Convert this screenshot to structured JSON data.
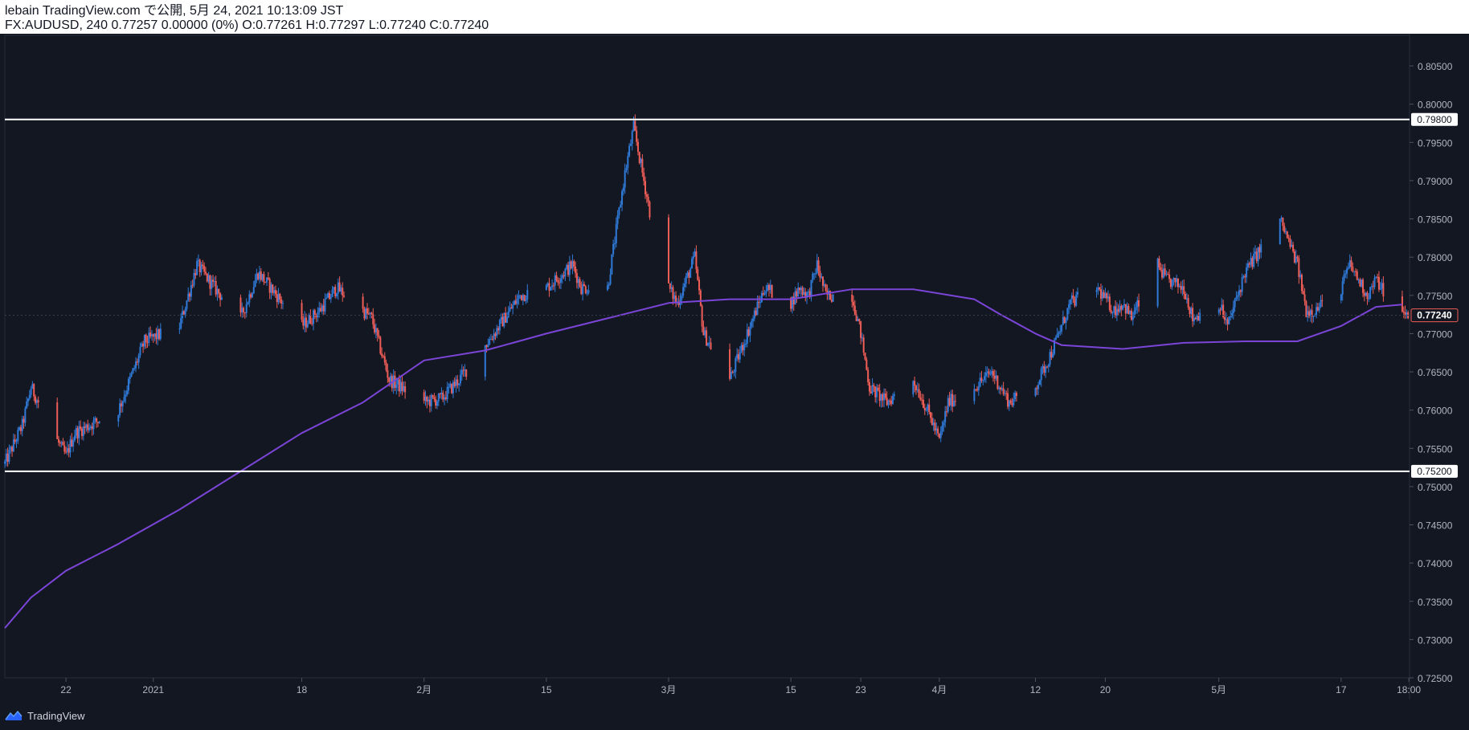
{
  "header": {
    "line1": "lebain TradingView.com で公開, 5月 24, 2021 10:13:09 JST",
    "line2": "FX:AUDUSD, 240 0.77257 0.00000 (0%) O:0.77261 H:0.77297 L:0.77240 C:0.77240"
  },
  "footer": {
    "brand": "TradingView",
    "logo_icon": "tradingview-logo-icon"
  },
  "colors": {
    "background": "#131722",
    "up": "#2f7ad8",
    "down": "#ef5d57",
    "ma": "#7b45d8",
    "level_line": "#ffffff",
    "axis_text": "#b2b5be",
    "grid": "#2a2e39"
  },
  "chart_data": {
    "type": "candlestick",
    "symbol": "FX:AUDUSD",
    "interval": "240",
    "ylim": [
      0.725,
      0.809
    ],
    "y_ticks": [
      "0.80500",
      "0.80000",
      "0.79500",
      "0.79000",
      "0.78500",
      "0.78000",
      "0.77500",
      "0.77000",
      "0.76500",
      "0.76000",
      "0.75500",
      "0.75000",
      "0.74500",
      "0.74000",
      "0.73500",
      "0.73000",
      "0.72500"
    ],
    "x_ticks": [
      {
        "label": "22",
        "date": "2020-12-22"
      },
      {
        "label": "2021",
        "date": "2021-01-01"
      },
      {
        "label": "18",
        "date": "2021-01-18"
      },
      {
        "label": "2月",
        "date": "2021-02-01"
      },
      {
        "label": "15",
        "date": "2021-02-15"
      },
      {
        "label": "3月",
        "date": "2021-03-01"
      },
      {
        "label": "15",
        "date": "2021-03-15"
      },
      {
        "label": "23",
        "date": "2021-03-23"
      },
      {
        "label": "4月",
        "date": "2021-04-01"
      },
      {
        "label": "12",
        "date": "2021-04-12"
      },
      {
        "label": "20",
        "date": "2021-04-20"
      },
      {
        "label": "5月",
        "date": "2021-05-03"
      },
      {
        "label": "17",
        "date": "2021-05-17"
      },
      {
        "label": "18:00",
        "date": "2021-05-24 18:00"
      }
    ],
    "price_path": [
      [
        "2020-12-15",
        0.753
      ],
      [
        "2020-12-17",
        0.758
      ],
      [
        "2020-12-18",
        0.763
      ],
      [
        "2020-12-21",
        0.756
      ],
      [
        "2020-12-22",
        0.754
      ],
      [
        "2020-12-23",
        0.757
      ],
      [
        "2020-12-28",
        0.76
      ],
      [
        "2020-12-31",
        0.769
      ],
      [
        "2021-01-04",
        0.771
      ],
      [
        "2021-01-06",
        0.779
      ],
      [
        "2021-01-08",
        0.776
      ],
      [
        "2021-01-11",
        0.772
      ],
      [
        "2021-01-13",
        0.778
      ],
      [
        "2021-01-18",
        0.771
      ],
      [
        "2021-01-20",
        0.773
      ],
      [
        "2021-01-22",
        0.776
      ],
      [
        "2021-01-26",
        0.772
      ],
      [
        "2021-01-28",
        0.764
      ],
      [
        "2021-02-01",
        0.761
      ],
      [
        "2021-02-03",
        0.7615
      ],
      [
        "2021-02-05",
        0.764
      ],
      [
        "2021-02-09",
        0.77
      ],
      [
        "2021-02-12",
        0.775
      ],
      [
        "2021-02-15",
        0.776
      ],
      [
        "2021-02-18",
        0.779
      ],
      [
        "2021-02-19",
        0.776
      ],
      [
        "2021-02-22",
        0.776
      ],
      [
        "2021-02-24",
        0.791
      ],
      [
        "2021-02-25",
        0.797
      ],
      [
        "2021-02-26",
        0.791
      ],
      [
        "2021-02-27",
        0.785
      ],
      [
        "2021-03-01",
        0.776
      ],
      [
        "2021-03-02",
        0.774
      ],
      [
        "2021-03-04",
        0.78
      ],
      [
        "2021-03-05",
        0.77
      ],
      [
        "2021-03-08",
        0.764
      ],
      [
        "2021-03-10",
        0.77
      ],
      [
        "2021-03-12",
        0.776
      ],
      [
        "2021-03-15",
        0.774
      ],
      [
        "2021-03-16",
        0.776
      ],
      [
        "2021-03-17",
        0.775
      ],
      [
        "2021-03-18",
        0.779
      ],
      [
        "2021-03-19",
        0.775
      ],
      [
        "2021-03-22",
        0.775
      ],
      [
        "2021-03-23",
        0.77
      ],
      [
        "2021-03-24",
        0.763
      ],
      [
        "2021-03-26",
        0.761
      ],
      [
        "2021-03-29",
        0.764
      ],
      [
        "2021-03-31",
        0.759
      ],
      [
        "2021-04-01",
        0.756
      ],
      [
        "2021-04-02",
        0.761
      ],
      [
        "2021-04-05",
        0.763
      ],
      [
        "2021-04-07",
        0.765
      ],
      [
        "2021-04-09",
        0.761
      ],
      [
        "2021-04-12",
        0.763
      ],
      [
        "2021-04-14",
        0.768
      ],
      [
        "2021-04-16",
        0.774
      ],
      [
        "2021-04-19",
        0.776
      ],
      [
        "2021-04-21",
        0.773
      ],
      [
        "2021-04-22",
        0.774
      ],
      [
        "2021-04-23",
        0.772
      ],
      [
        "2021-04-26",
        0.779
      ],
      [
        "2021-04-27",
        0.777
      ],
      [
        "2021-04-29",
        0.776
      ],
      [
        "2021-04-30",
        0.772
      ],
      [
        "2021-05-03",
        0.774
      ],
      [
        "2021-05-04",
        0.771
      ],
      [
        "2021-05-06",
        0.778
      ],
      [
        "2021-05-10",
        0.785
      ],
      [
        "2021-05-12",
        0.779
      ],
      [
        "2021-05-13",
        0.773
      ],
      [
        "2021-05-14",
        0.773
      ],
      [
        "2021-05-17",
        0.776
      ],
      [
        "2021-05-18",
        0.779
      ],
      [
        "2021-05-20",
        0.775
      ],
      [
        "2021-05-21",
        0.777
      ],
      [
        "2021-05-24",
        0.7724
      ]
    ],
    "moving_average": [
      [
        "2020-12-15",
        0.7315
      ],
      [
        "2020-12-18",
        0.7355
      ],
      [
        "2020-12-22",
        0.739
      ],
      [
        "2020-12-28",
        0.7425
      ],
      [
        "2021-01-04",
        0.747
      ],
      [
        "2021-01-11",
        0.752
      ],
      [
        "2021-01-18",
        0.757
      ],
      [
        "2021-01-25",
        0.761
      ],
      [
        "2021-02-01",
        0.7665
      ],
      [
        "2021-02-08",
        0.7678
      ],
      [
        "2021-02-15",
        0.77
      ],
      [
        "2021-02-22",
        0.772
      ],
      [
        "2021-03-01",
        0.774
      ],
      [
        "2021-03-08",
        0.7745
      ],
      [
        "2021-03-15",
        0.7745
      ],
      [
        "2021-03-22",
        0.7758
      ],
      [
        "2021-03-29",
        0.7758
      ],
      [
        "2021-04-05",
        0.7745
      ],
      [
        "2021-04-08",
        0.7725
      ],
      [
        "2021-04-12",
        0.77
      ],
      [
        "2021-04-15",
        0.7685
      ],
      [
        "2021-04-22",
        0.768
      ],
      [
        "2021-04-29",
        0.7688
      ],
      [
        "2021-05-06",
        0.769
      ],
      [
        "2021-05-12",
        0.769
      ],
      [
        "2021-05-17",
        0.771
      ],
      [
        "2021-05-21",
        0.7735
      ],
      [
        "2021-05-24",
        0.7738
      ]
    ],
    "horizontal_levels": [
      {
        "label": "0.79800",
        "value": 0.798
      },
      {
        "label": "0.75200",
        "value": 0.752
      }
    ],
    "last_price": {
      "label": "0.77240",
      "value": 0.7724
    },
    "time_range": [
      "2020-12-15",
      "2021-05-24 20:00"
    ]
  }
}
